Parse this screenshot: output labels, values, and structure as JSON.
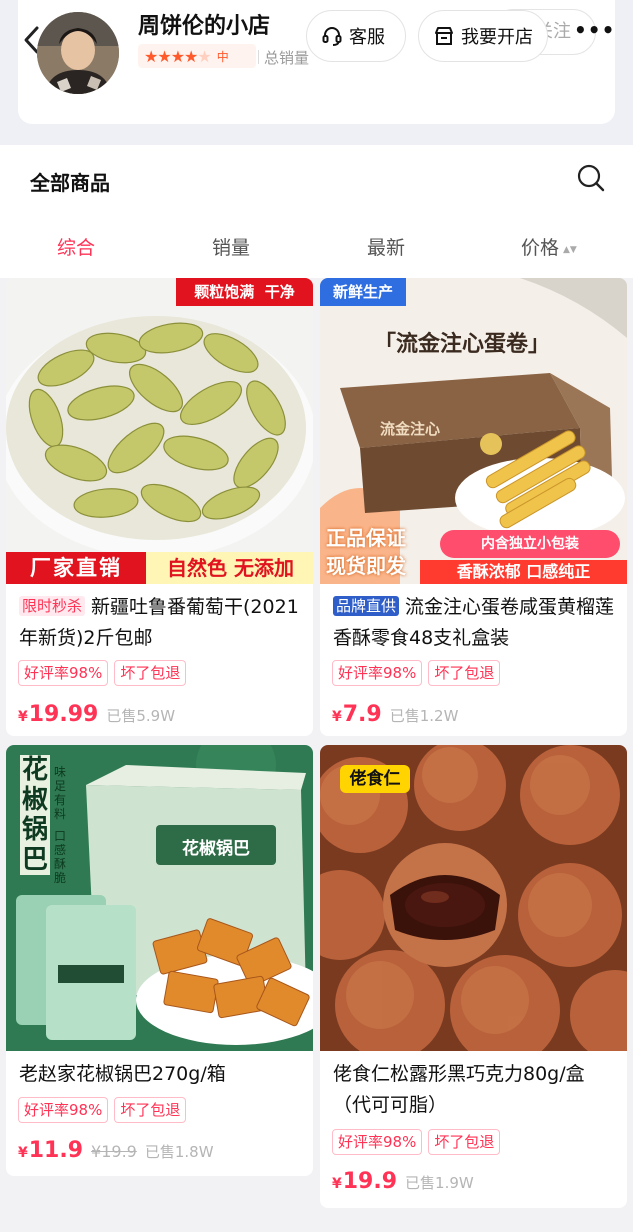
{
  "header": {
    "shop_name": "周饼伦的小店",
    "rating_level": "中",
    "rating_stars": 4,
    "sales_total_label": "总销量",
    "follow_label": "关注",
    "service_button": "客服",
    "open_shop_button": "我要开店",
    "more_label": "•••"
  },
  "section": {
    "title": "全部商品",
    "sort_tabs": [
      {
        "label": "综合",
        "active": true
      },
      {
        "label": "销量",
        "active": false
      },
      {
        "label": "最新",
        "active": false
      },
      {
        "label": "价格",
        "active": false
      }
    ]
  },
  "products": [
    {
      "badge": "限时秒杀",
      "title": "新疆吐鲁番葡萄干(2021年新货)2斤包邮",
      "chips": [
        "好评率98%",
        "坏了包退"
      ],
      "currency": "¥",
      "price": "19.99",
      "old_price": "",
      "sold": "已售5.9W",
      "image_texts": {
        "top_banner": "颗粒饱满  干净",
        "bottom_left": "厂家直销",
        "bottom_right": "自然色 无添加"
      }
    },
    {
      "badge": "品牌直供",
      "title": "流金注心蛋卷咸蛋黄榴莲香酥零食48支礼盒装",
      "chips": [
        "好评率98%",
        "坏了包退"
      ],
      "currency": "¥",
      "price": "7.9",
      "old_price": "",
      "sold": "已售1.2W",
      "image_texts": {
        "corner": "新鲜生产",
        "headline": "「流金注心蛋卷」",
        "box_label": "流金注心",
        "promise_1": "正品保证",
        "promise_2": "现货即发",
        "pack": "内含独立小包装",
        "taste": "香酥浓郁 口感纯正"
      }
    },
    {
      "badge": "",
      "title": "老赵家花椒锅巴270g/箱",
      "chips": [
        "好评率98%",
        "坏了包退"
      ],
      "currency": "¥",
      "price": "11.9",
      "old_price": "¥19.9",
      "sold": "已售1.8W",
      "image_texts": {
        "vertical_title": "花椒锅巴",
        "side_note_1": "味足有料",
        "side_note_2": "口感酥脆",
        "box_label": "花椒锅巴"
      }
    },
    {
      "badge": "",
      "title": "佬食仁松露形黑巧克力80g/盒 （代可可脂）",
      "chips": [
        "好评率98%",
        "坏了包退"
      ],
      "currency": "¥",
      "price": "19.9",
      "old_price": "",
      "sold": "已售1.9W",
      "image_texts": {
        "logo": "佬食仁"
      }
    }
  ],
  "colors": {
    "accent": "#ff3355",
    "star": "#ff5a2c",
    "brand_badge": "#2f5ec8"
  }
}
